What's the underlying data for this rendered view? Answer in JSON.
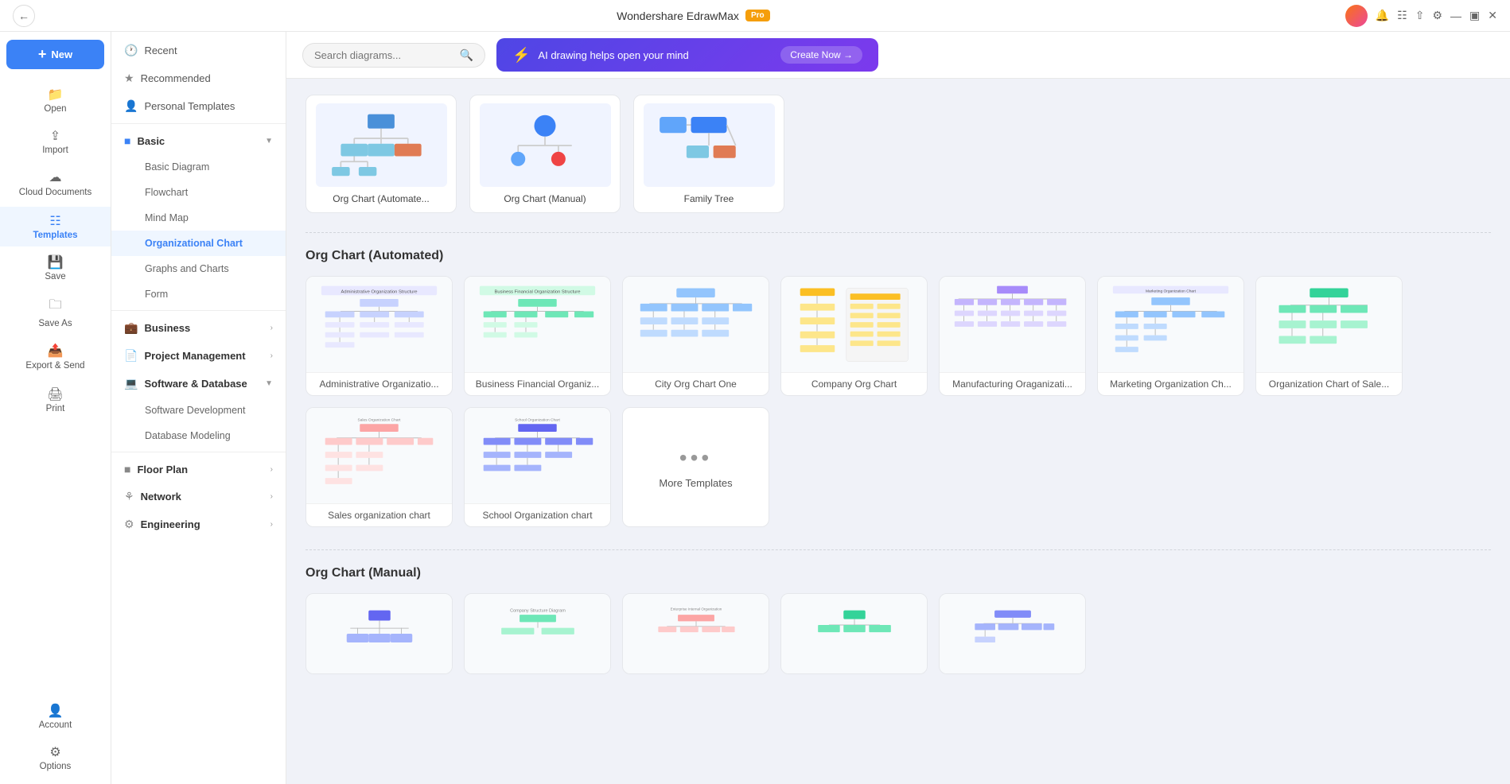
{
  "app": {
    "title": "Wondershare EdrawMax",
    "pro_badge": "Pro"
  },
  "topbar": {
    "search_placeholder": "Search diagrams...",
    "ai_banner": "AI drawing helps open your mind",
    "create_now": "Create Now →"
  },
  "sidebar": {
    "items": [
      {
        "id": "new",
        "label": "New",
        "icon": "new-icon"
      },
      {
        "id": "open",
        "label": "Open",
        "icon": "open-icon"
      },
      {
        "id": "import",
        "label": "Import",
        "icon": "import-icon"
      },
      {
        "id": "cloud",
        "label": "Cloud Documents",
        "icon": "cloud-icon"
      },
      {
        "id": "templates",
        "label": "Templates",
        "icon": "templates-icon"
      },
      {
        "id": "save",
        "label": "Save",
        "icon": "save-icon"
      },
      {
        "id": "saveas",
        "label": "Save As",
        "icon": "saveas-icon"
      },
      {
        "id": "export",
        "label": "Export & Send",
        "icon": "export-icon"
      },
      {
        "id": "print",
        "label": "Print",
        "icon": "print-icon"
      },
      {
        "id": "account",
        "label": "Account",
        "icon": "account-icon"
      },
      {
        "id": "options",
        "label": "Options",
        "icon": "options-icon"
      }
    ]
  },
  "nav": {
    "items": [
      {
        "id": "recent",
        "label": "Recent",
        "type": "item",
        "icon": "clock"
      },
      {
        "id": "recommended",
        "label": "Recommended",
        "type": "item",
        "icon": "star"
      },
      {
        "id": "personal",
        "label": "Personal Templates",
        "type": "item",
        "icon": "user"
      },
      {
        "id": "basic",
        "label": "Basic",
        "type": "section",
        "expanded": true
      },
      {
        "id": "basic-diagram",
        "label": "Basic Diagram",
        "type": "sub"
      },
      {
        "id": "flowchart",
        "label": "Flowchart",
        "type": "sub"
      },
      {
        "id": "mind-map",
        "label": "Mind Map",
        "type": "sub"
      },
      {
        "id": "org-chart",
        "label": "Organizational Chart",
        "type": "sub",
        "active": true
      },
      {
        "id": "graphs",
        "label": "Graphs and Charts",
        "type": "sub"
      },
      {
        "id": "form",
        "label": "Form",
        "type": "sub"
      },
      {
        "id": "business",
        "label": "Business",
        "type": "section"
      },
      {
        "id": "project",
        "label": "Project Management",
        "type": "section"
      },
      {
        "id": "software",
        "label": "Software & Database",
        "type": "section",
        "expanded": true
      },
      {
        "id": "sw-dev",
        "label": "Software Development",
        "type": "sub2"
      },
      {
        "id": "db-model",
        "label": "Database Modeling",
        "type": "sub2"
      },
      {
        "id": "floor-plan",
        "label": "Floor Plan",
        "type": "section"
      },
      {
        "id": "network",
        "label": "Network",
        "type": "section"
      },
      {
        "id": "engineering",
        "label": "Engineering",
        "type": "section"
      }
    ]
  },
  "top_templates": [
    {
      "id": "org-auto",
      "label": "Org Chart (Automate..."
    },
    {
      "id": "org-manual",
      "label": "Org Chart (Manual)"
    },
    {
      "id": "family-tree",
      "label": "Family Tree"
    }
  ],
  "automated_section": {
    "title": "Org Chart (Automated)",
    "cards": [
      {
        "id": "admin-org",
        "label": "Administrative Organizatio..."
      },
      {
        "id": "biz-fin",
        "label": "Business Financial Organiz..."
      },
      {
        "id": "city-org",
        "label": "City Org Chart One"
      },
      {
        "id": "company-org",
        "label": "Company Org Chart"
      },
      {
        "id": "mfg-org",
        "label": "Manufacturing Oraganizati..."
      },
      {
        "id": "marketing-org",
        "label": "Marketing Organization Ch..."
      },
      {
        "id": "sales-chart",
        "label": "Organization Chart of Sale..."
      },
      {
        "id": "sales-org",
        "label": "Sales organization chart"
      },
      {
        "id": "school-org",
        "label": "School Organization chart"
      },
      {
        "id": "more",
        "label": "More Templates",
        "is_more": true
      }
    ]
  },
  "manual_section": {
    "title": "Org Chart (Manual)"
  }
}
